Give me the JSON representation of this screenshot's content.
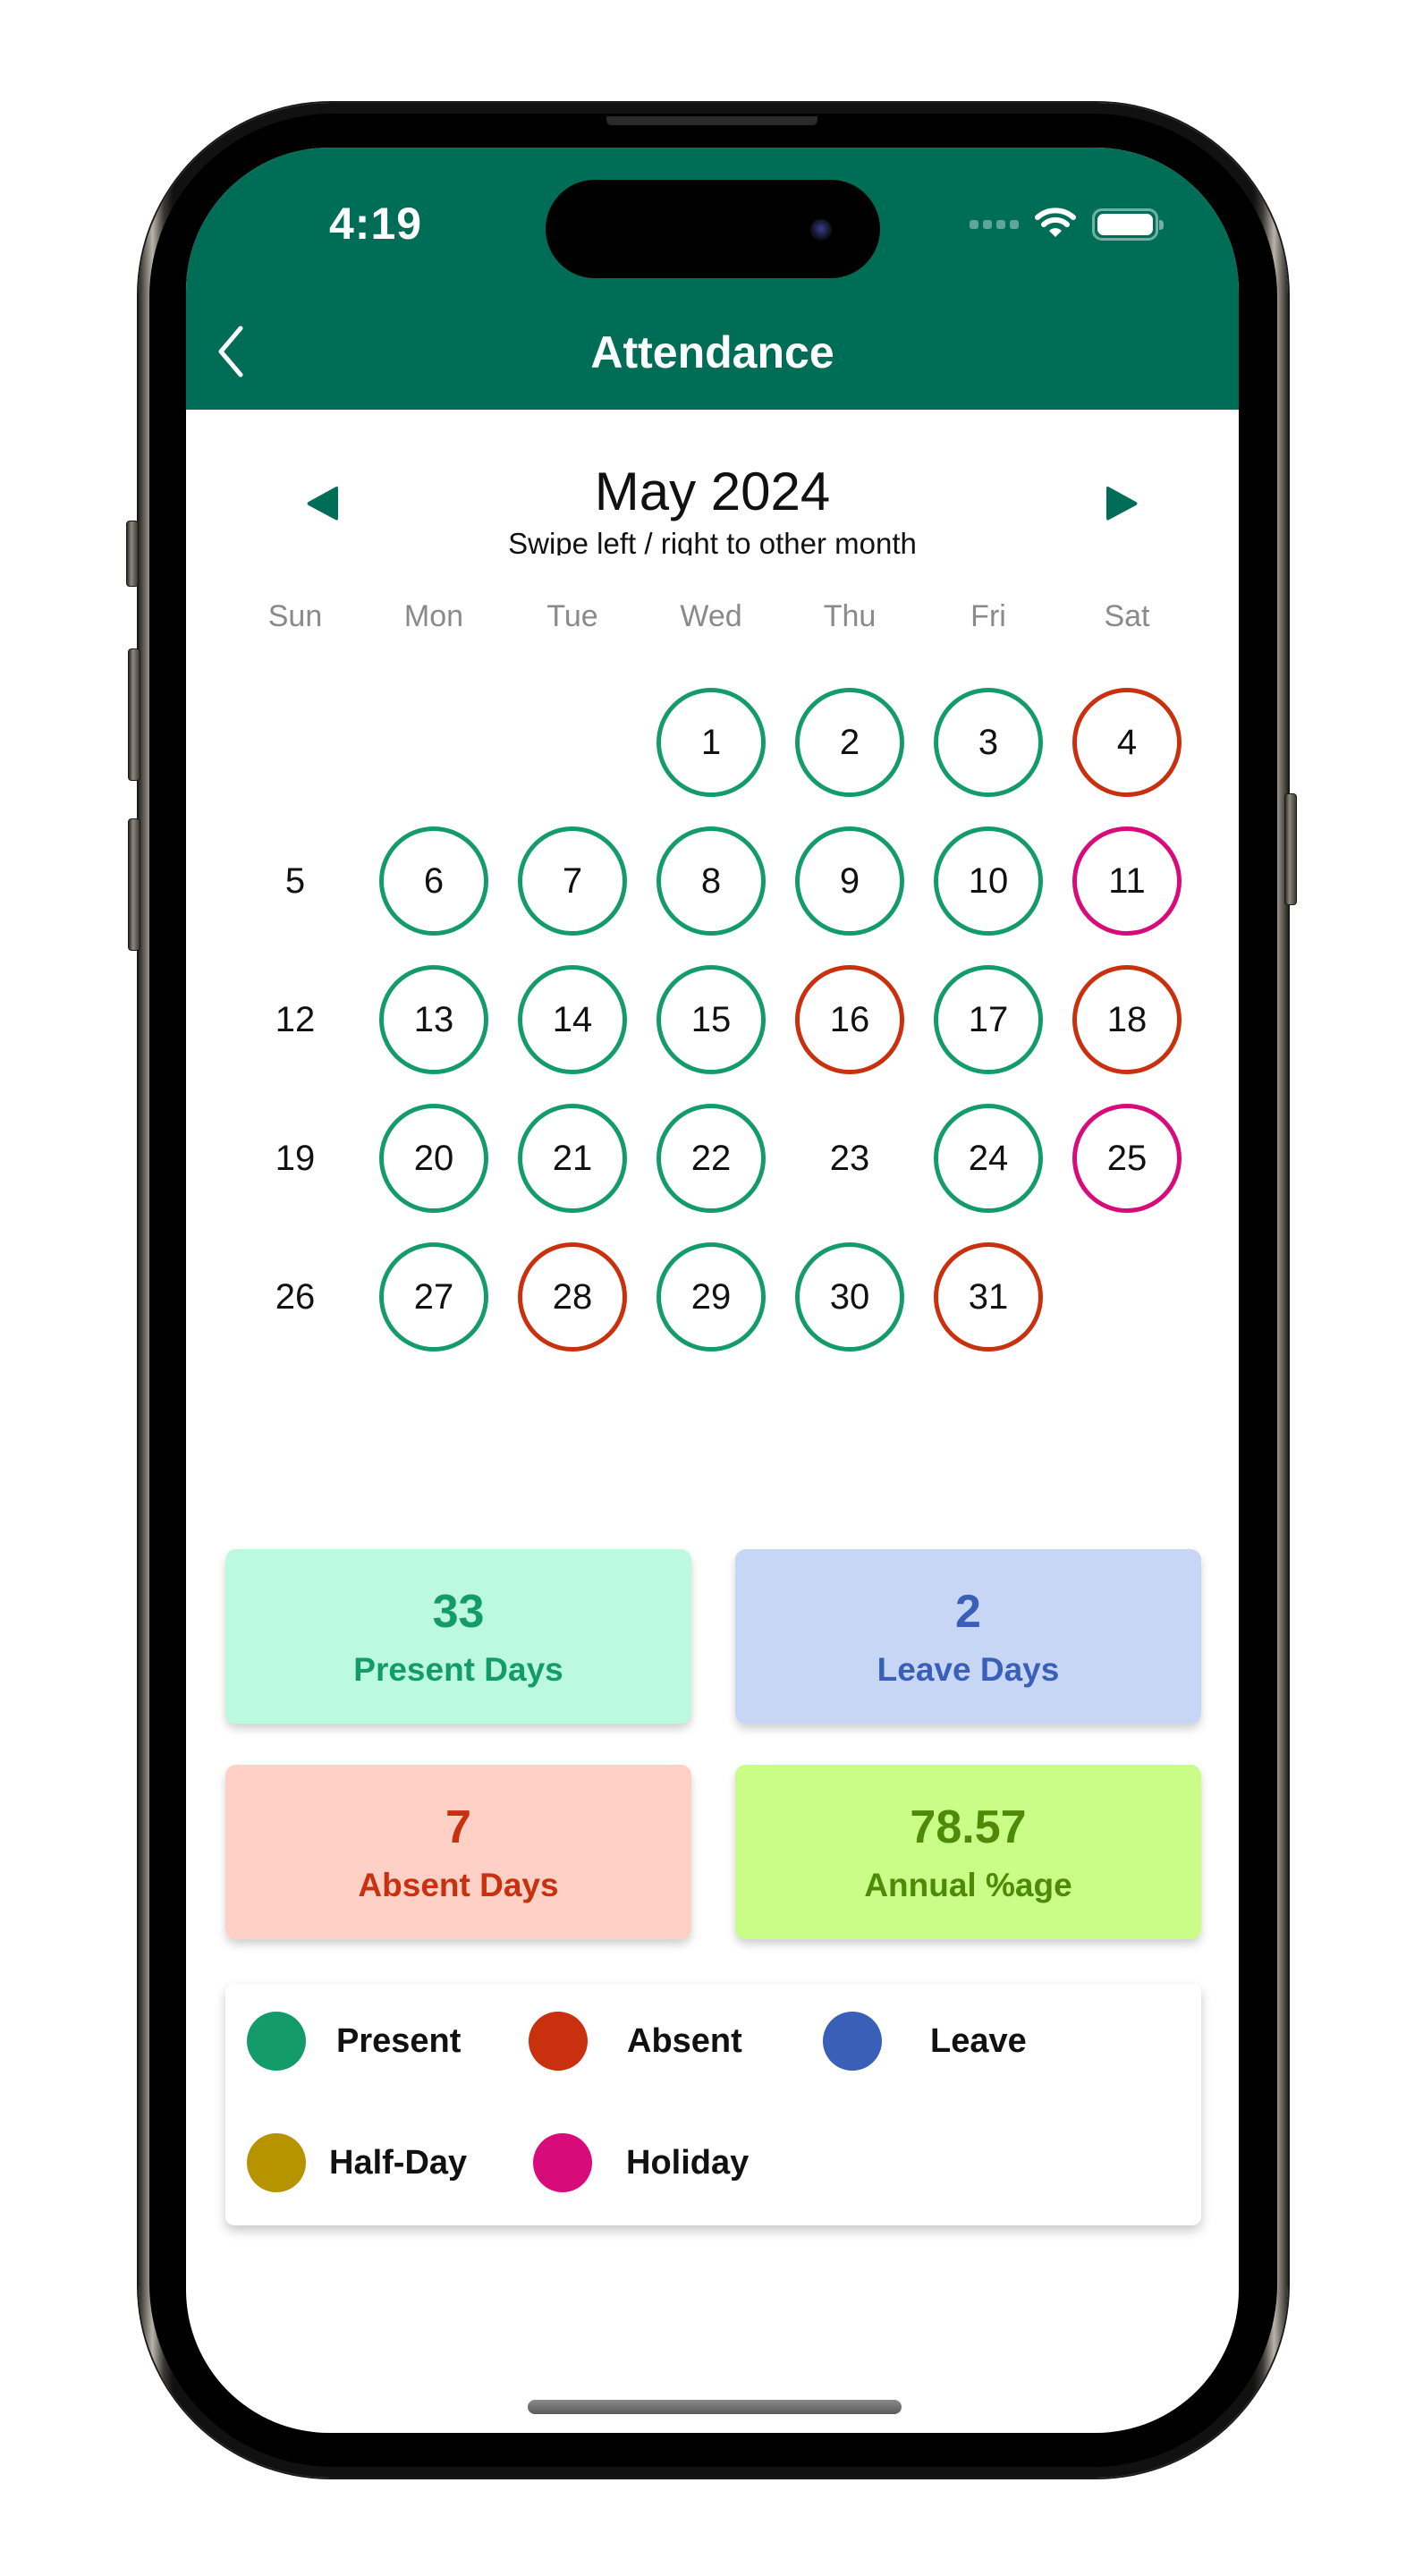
{
  "status_bar": {
    "time": "4:19",
    "wifi_icon": "wifi-icon",
    "battery_icon": "battery-icon",
    "signal_icon": "cellular-signal-icon"
  },
  "header": {
    "title": "Attendance",
    "back_icon": "chevron-left-icon",
    "background_color": "#006E57"
  },
  "calendar": {
    "month_label": "May 2024",
    "subtitle": "Swipe left / right to other month",
    "prev_icon": "triangle-left-icon",
    "next_icon": "triangle-right-icon",
    "weekdays": [
      "Sun",
      "Mon",
      "Tue",
      "Wed",
      "Thu",
      "Fri",
      "Sat"
    ],
    "first_weekday_index": 3,
    "days": [
      {
        "day": "1",
        "status": "present"
      },
      {
        "day": "2",
        "status": "present"
      },
      {
        "day": "3",
        "status": "present"
      },
      {
        "day": "4",
        "status": "absent"
      },
      {
        "day": "5",
        "status": "none"
      },
      {
        "day": "6",
        "status": "present"
      },
      {
        "day": "7",
        "status": "present"
      },
      {
        "day": "8",
        "status": "present"
      },
      {
        "day": "9",
        "status": "present"
      },
      {
        "day": "10",
        "status": "present"
      },
      {
        "day": "11",
        "status": "holiday"
      },
      {
        "day": "12",
        "status": "none"
      },
      {
        "day": "13",
        "status": "present"
      },
      {
        "day": "14",
        "status": "present"
      },
      {
        "day": "15",
        "status": "present"
      },
      {
        "day": "16",
        "status": "absent"
      },
      {
        "day": "17",
        "status": "present"
      },
      {
        "day": "18",
        "status": "absent"
      },
      {
        "day": "19",
        "status": "none"
      },
      {
        "day": "20",
        "status": "present"
      },
      {
        "day": "21",
        "status": "present"
      },
      {
        "day": "22",
        "status": "present"
      },
      {
        "day": "23",
        "status": "none"
      },
      {
        "day": "24",
        "status": "present"
      },
      {
        "day": "25",
        "status": "holiday"
      },
      {
        "day": "26",
        "status": "none"
      },
      {
        "day": "27",
        "status": "present"
      },
      {
        "day": "28",
        "status": "absent"
      },
      {
        "day": "29",
        "status": "present"
      },
      {
        "day": "30",
        "status": "present"
      },
      {
        "day": "31",
        "status": "absent"
      }
    ]
  },
  "status_colors": {
    "present": "#139C6A",
    "absent": "#C9310E",
    "leave": "#3A5FB8",
    "half_day": "#B89300",
    "holiday": "#D70C7A"
  },
  "summary": {
    "present": {
      "value": "33",
      "label": "Present Days",
      "bg": "#BBF9E1",
      "fg": "#139C6A"
    },
    "leave": {
      "value": "2",
      "label": "Leave Days",
      "bg": "#C8D6F5",
      "fg": "#3A5FB8"
    },
    "absent": {
      "value": "7",
      "label": "Absent Days",
      "bg": "#FFD0C5",
      "fg": "#C9310E"
    },
    "annual": {
      "value": "78.57",
      "label": "Annual %age",
      "bg": "#C9FD88",
      "fg": "#4C8A07"
    }
  },
  "legend": {
    "items": [
      {
        "label": "Present",
        "color": "#139C6A"
      },
      {
        "label": "Absent",
        "color": "#C9310E"
      },
      {
        "label": "Leave",
        "color": "#3A5FB8"
      },
      {
        "label": "Half-Day",
        "color": "#B89300"
      },
      {
        "label": "Holiday",
        "color": "#D70C7A"
      }
    ]
  }
}
